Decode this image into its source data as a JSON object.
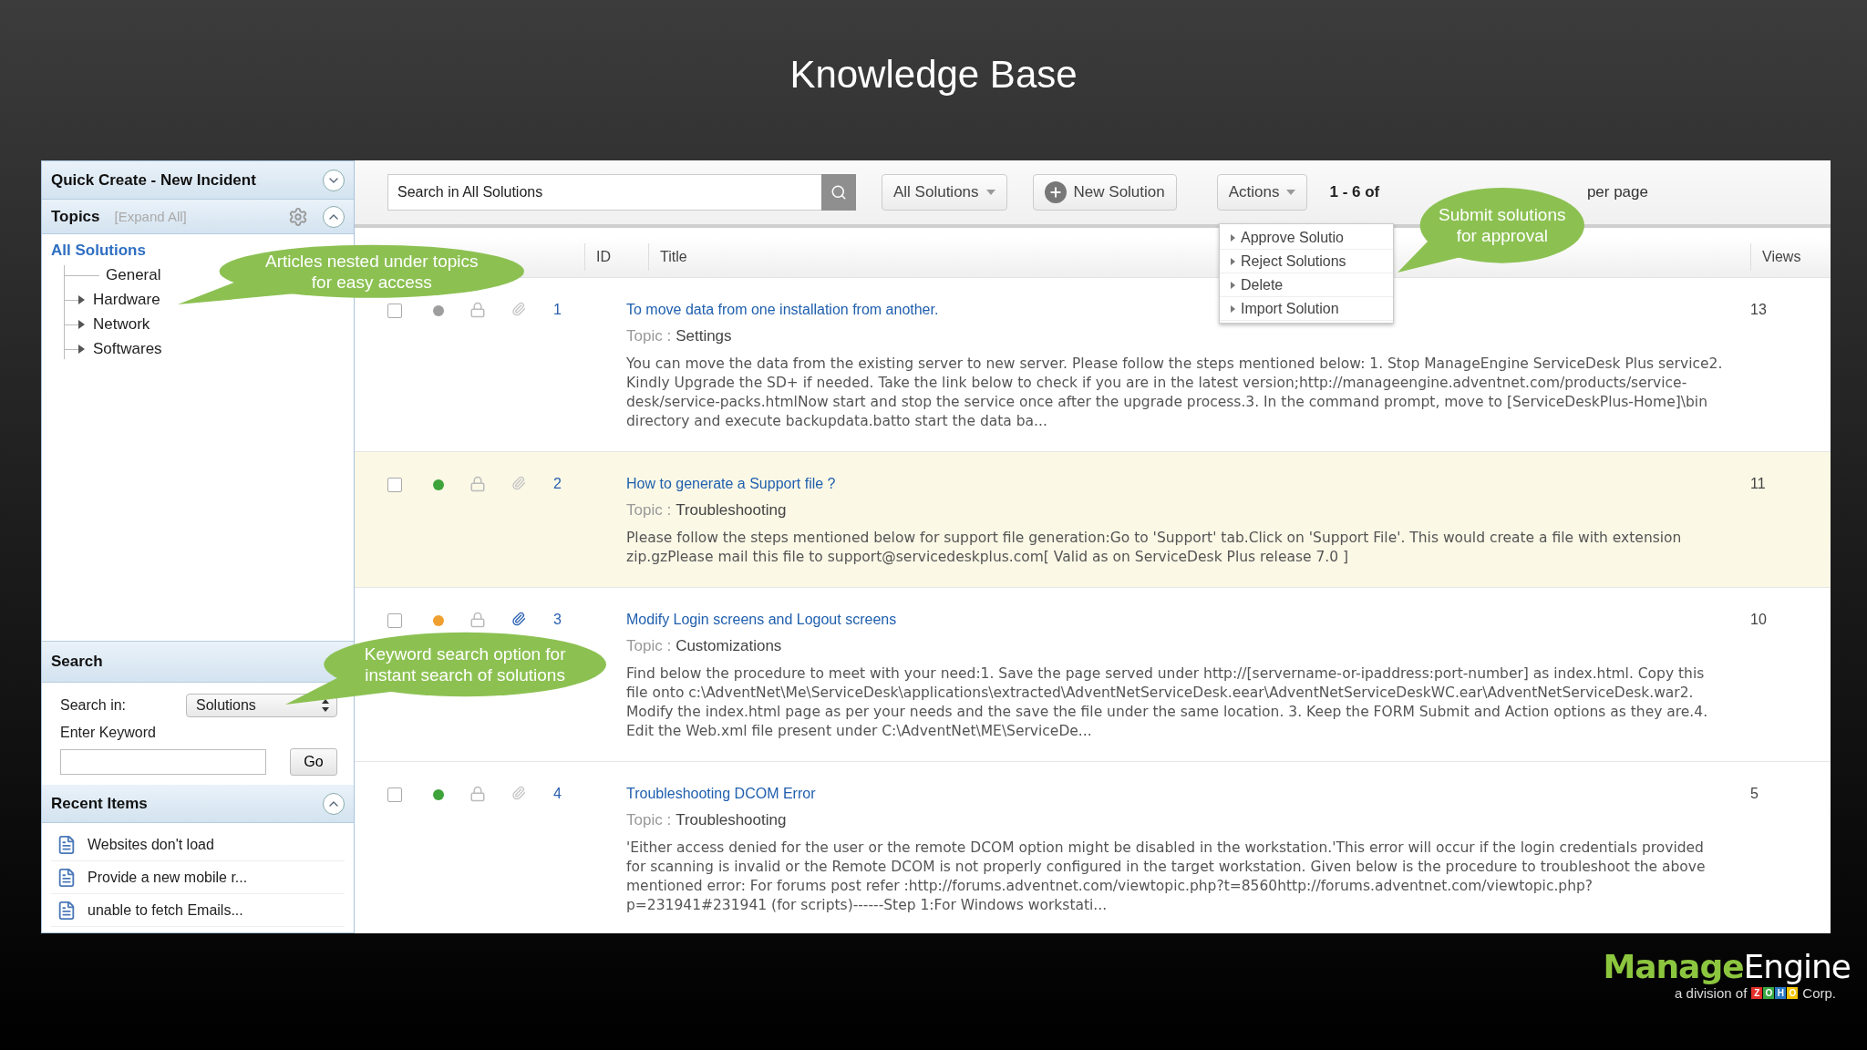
{
  "slide_title": "Knowledge Base",
  "sidebar": {
    "quick_create": {
      "title": "Quick Create - New Incident",
      "expanded": false
    },
    "topics": {
      "title": "Topics",
      "expand_all": "[Expand All]",
      "expanded": true,
      "tree": [
        {
          "label": "All Solutions",
          "selected": true,
          "children": [
            {
              "label": "General",
              "expandable": false,
              "selected": false
            },
            {
              "label": "Hardware",
              "expandable": true,
              "selected": false
            },
            {
              "label": "Network",
              "expandable": true,
              "selected": false
            },
            {
              "label": "Softwares",
              "expandable": true,
              "selected": false
            }
          ]
        }
      ]
    },
    "search": {
      "title": "Search",
      "search_in_label": "Search in:",
      "search_in_value": "Solutions",
      "keyword_label": "Enter Keyword",
      "go": "Go"
    },
    "recent": {
      "title": "Recent Items",
      "expanded": true,
      "items": [
        "Websites don't load",
        "Provide a new mobile r...",
        "unable to fetch Emails..."
      ]
    }
  },
  "toolbar": {
    "search_placeholder": "Search in All Solutions",
    "filter": "All Solutions",
    "new_button": "New Solution",
    "actions": "Actions",
    "range": "1 - 6 of",
    "per_page": "per page"
  },
  "actions_menu": [
    "Approve Solutio",
    "Reject Solutions",
    "Delete",
    "Import Solution"
  ],
  "columns": [
    "ID",
    "Title",
    "Views"
  ],
  "rows": [
    {
      "id": "1",
      "title": "To move data from one installation from another.",
      "topic_label": "Topic :",
      "topic": "Settings",
      "description": "You can move the data from the existing server to new server. Please follow the steps mentioned below: 1. Stop ManageEngine ServiceDesk Plus service2. Kindly Upgrade the SD+ if needed. Take the link below to check if you are in the latest version;http://manageengine.adventnet.com/products/service-desk/service-packs.htmlNow start and stop the service once after the upgrade process.3. In the command prompt, move to [ServiceDeskPlus-Home]\\bin directory and execute backupdata.batto start the data ba...",
      "views": "13",
      "highlighted": false,
      "color": "#9e9e9e",
      "attachment": false
    },
    {
      "id": "2",
      "title": "How to generate a Support file ?",
      "topic_label": "Topic :",
      "topic": "Troubleshooting",
      "description": "Please follow the steps mentioned below for support file generation:Go to 'Support' tab.Click on 'Support File'. This would create a file with extension zip.gzPlease mail this file to support@servicedeskplus.com[ Valid as on ServiceDesk Plus release 7.0 ]",
      "views": "11",
      "highlighted": true,
      "color": "#3da33a",
      "attachment": false
    },
    {
      "id": "3",
      "title": "Modify Login screens and Logout screens",
      "topic_label": "Topic :",
      "topic": "Customizations",
      "description": "Find below the procedure to meet with your need:1. Save the page served under http://[servername-or-ipaddress:port-number] as index.html. Copy this file onto c:\\AdventNet\\Me\\ServiceDesk\\applications\\extracted\\AdventNetServiceDesk.eear\\AdventNetServiceDeskWC.ear\\AdventNetServiceDesk.war2. Modify the index.html page as per your needs and the save the file under the same location. 3. Keep the FORM Submit and Action options as they are.4. Edit the Web.xml file present under C:\\AdventNet\\ME\\ServiceDe...",
      "views": "10",
      "highlighted": false,
      "color": "#f0a030",
      "attachment": true
    },
    {
      "id": "4",
      "title": "Troubleshooting DCOM Error",
      "topic_label": "Topic :",
      "topic": "Troubleshooting",
      "description": "'Either access denied for the user or the remote DCOM option might be disabled in the workstation.'This error will occur if the login credentials provided for scanning is invalid or the Remote DCOM is not properly configured in the target workstation. Given below is the procedure to troubleshoot the above mentioned error: For forums post refer :http://forums.adventnet.com/viewtopic.php?t=8560http://forums.adventnet.com/viewtopic.php?p=231941#231941 (for scripts)------Step 1:For Windows workstati...",
      "views": "5",
      "highlighted": false,
      "color": "#3da33a",
      "attachment": false
    }
  ],
  "callouts": [
    {
      "lines": [
        "Articles nested under topics",
        "for easy access"
      ]
    },
    {
      "lines": [
        "Submit solutions",
        "for approval"
      ]
    },
    {
      "lines": [
        "Keyword search option for",
        "instant search of solutions"
      ]
    }
  ],
  "logo": {
    "bold": "Manage",
    "rest": "Engine",
    "tagline_before": "a division of",
    "zoho": [
      {
        "letter": "Z",
        "color": "#e4312b"
      },
      {
        "letter": "O",
        "color": "#3aa845"
      },
      {
        "letter": "H",
        "color": "#2a79c5"
      },
      {
        "letter": "O",
        "color": "#f5c400"
      }
    ],
    "tagline_after": "Corp."
  }
}
